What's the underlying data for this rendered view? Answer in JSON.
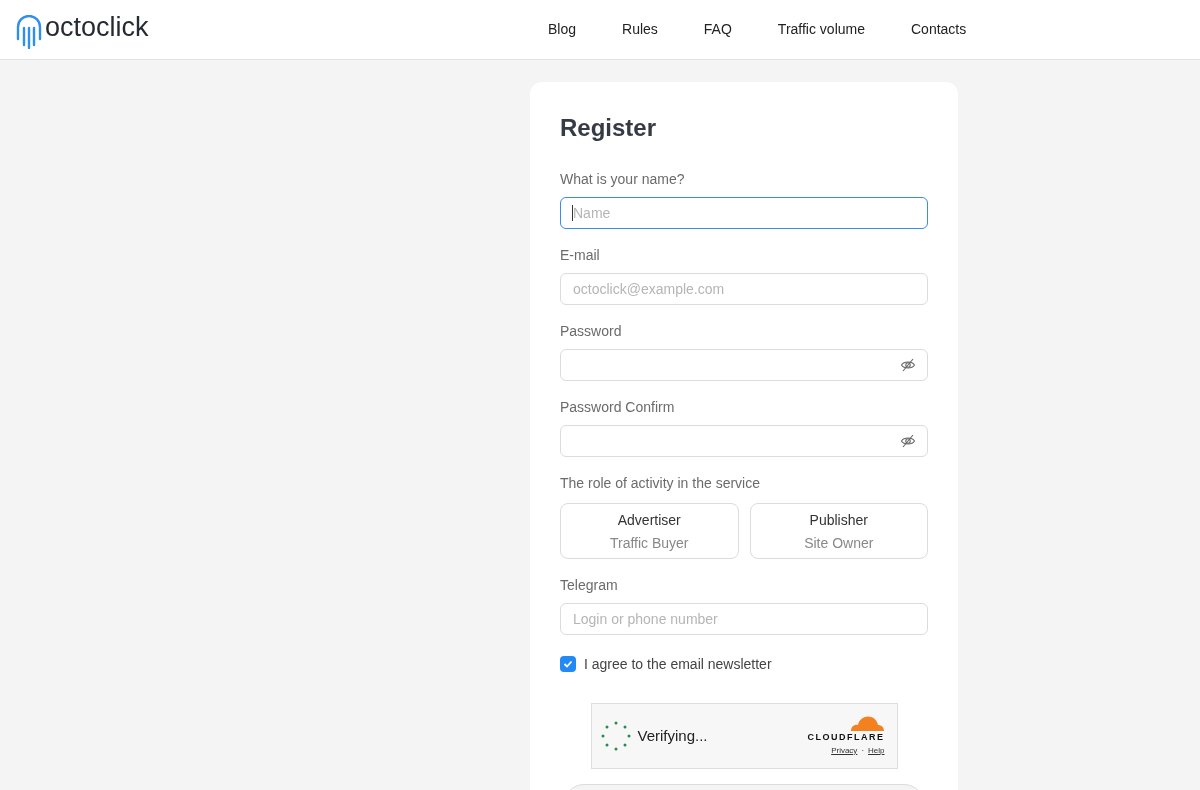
{
  "header": {
    "logo_text": "octoclick",
    "nav": [
      "Blog",
      "Rules",
      "FAQ",
      "Traffic volume",
      "Contacts"
    ]
  },
  "form": {
    "title": "Register",
    "fields": [
      {
        "kind": "text",
        "label": "What is your name?",
        "placeholder": "Name",
        "focused": true
      },
      {
        "kind": "text",
        "label": "E-mail",
        "placeholder": "octoclick@example.com",
        "focused": false
      },
      {
        "kind": "password",
        "label": "Password",
        "focused": false
      },
      {
        "kind": "password",
        "label": "Password Confirm",
        "focused": false
      }
    ],
    "role_label": "The role of activity in the service",
    "roles": [
      {
        "title": "Advertiser",
        "subtitle": "Traffic Buyer",
        "selected": false
      },
      {
        "title": "Publisher",
        "subtitle": "Site Owner",
        "selected": false
      }
    ],
    "telegram": {
      "label": "Telegram",
      "placeholder": "Login or phone number"
    },
    "newsletter": {
      "label": "I agree to the email newsletter",
      "checked": true
    },
    "captcha": {
      "status": "Verifying...",
      "brand": "CLOUDFLARE",
      "links": [
        "Privacy",
        "Help"
      ],
      "separator": "·"
    }
  }
}
